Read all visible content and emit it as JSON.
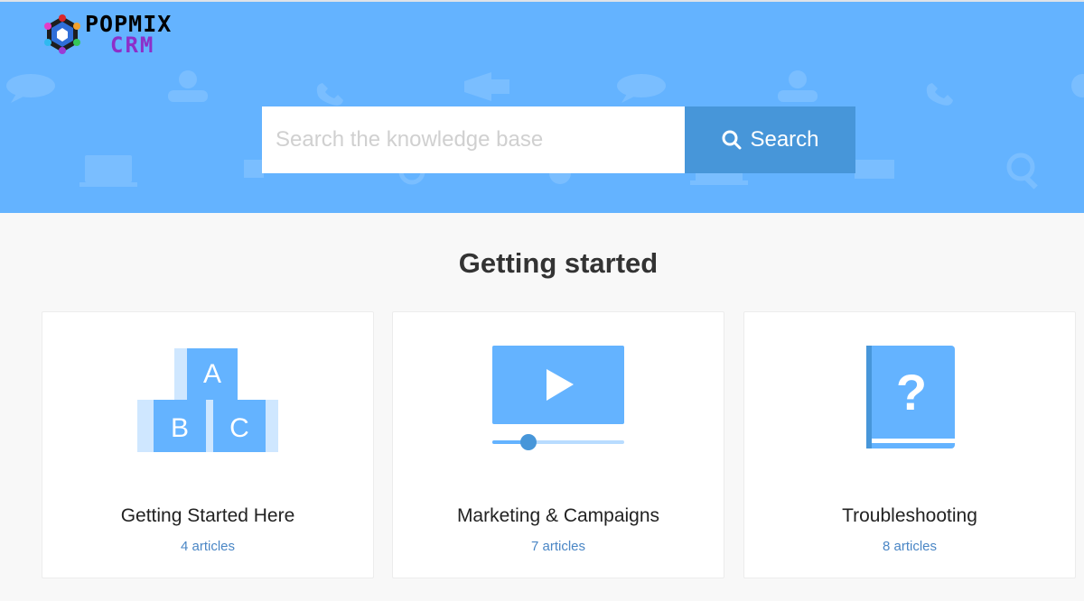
{
  "brand": {
    "logo_top": "POPMIX",
    "logo_bottom": "CRM"
  },
  "search": {
    "placeholder": "Search the knowledge base",
    "button_label": "Search"
  },
  "main": {
    "section_title": "Getting started",
    "categories": [
      {
        "title": "Getting Started Here",
        "count": "4 articles",
        "icon": "abc-blocks-icon"
      },
      {
        "title": "Marketing & Campaigns",
        "count": "7 articles",
        "icon": "video-player-icon"
      },
      {
        "title": "Troubleshooting",
        "count": "8 articles",
        "icon": "question-book-icon"
      }
    ]
  },
  "colors": {
    "hero": "#64b3ff",
    "search_button": "#4796d9",
    "icon_blue": "#64b3ff",
    "link": "#4a86c5"
  }
}
